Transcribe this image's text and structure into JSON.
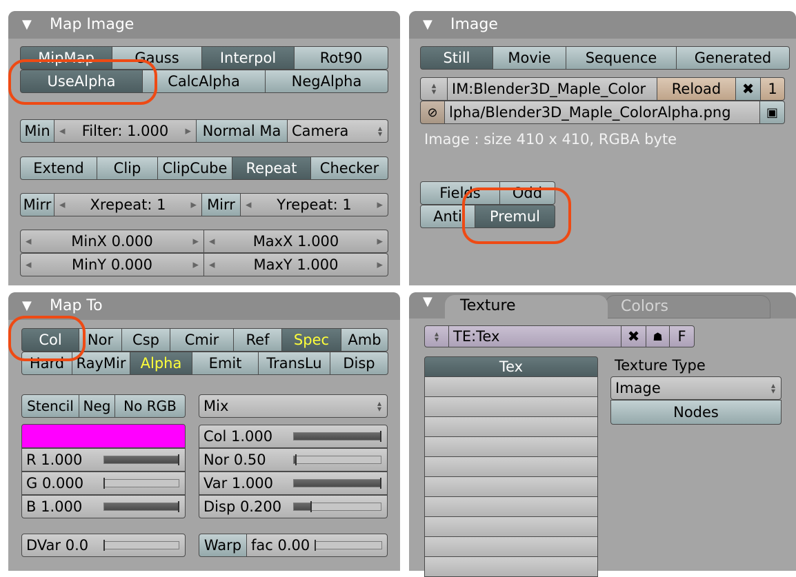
{
  "colors": {
    "highlight": "#ee4a14",
    "swatch": "#ff00ff",
    "active_button": "#4f6164",
    "yellow_text": "#ffff3a"
  },
  "map_image": {
    "title": "Map Image",
    "row1": [
      "MipMap",
      "Gauss",
      "Interpol",
      "Rot90"
    ],
    "row2": [
      "UseAlpha",
      "CalcAlpha",
      "NegAlpha"
    ],
    "filter": {
      "min_label": "Min",
      "filter_value": "Filter: 1.000",
      "normal_map": "Normal Ma",
      "space": "Camera"
    },
    "extend_row": [
      "Extend",
      "Clip",
      "ClipCube",
      "Repeat",
      "Checker"
    ],
    "repeat": {
      "mirr_x": "Mirr",
      "xrepeat": "Xrepeat: 1",
      "mirr_y": "Mirr",
      "yrepeat": "Yrepeat: 1"
    },
    "crop": {
      "minx": "MinX 0.000",
      "maxx": "MaxX 1.000",
      "miny": "MinY 0.000",
      "maxy": "MaxY 1.000"
    }
  },
  "image": {
    "title": "Image",
    "source_tabs": [
      "Still",
      "Movie",
      "Sequence",
      "Generated"
    ],
    "datablock": "IM:Blender3D_Maple_Color",
    "reload": "Reload",
    "users": "1",
    "filepath": "lpha/Blender3D_Maple_ColorAlpha.png",
    "info": "Image : size 410 x 410, RGBA byte",
    "fields": "Fields",
    "odd": "Odd",
    "anti": "Anti",
    "premul": "Premul"
  },
  "map_to": {
    "title": "Map To",
    "row1": [
      "Col",
      "Nor",
      "Csp",
      "Cmir",
      "Ref",
      "Spec",
      "Amb"
    ],
    "row2": [
      "Hard",
      "RayMir",
      "Alpha",
      "Emit",
      "TransLu",
      "Disp"
    ],
    "stencil": "Stencil",
    "neg": "Neg",
    "no_rgb": "No RGB",
    "blend_mode": "Mix",
    "r": {
      "label": "R 1.000",
      "value": 1.0
    },
    "g": {
      "label": "G 0.000",
      "value": 0.0
    },
    "b": {
      "label": "B 1.000",
      "value": 1.0
    },
    "col": {
      "label": "Col 1.000",
      "value": 1.0
    },
    "nor": {
      "label": "Nor 0.50",
      "value": 0.02
    },
    "var": {
      "label": "Var 1.000",
      "value": 1.0
    },
    "disp": {
      "label": "Disp 0.200",
      "value": 0.2
    },
    "dvar": {
      "label": "DVar 0.0",
      "value": 0.0
    },
    "warp": "Warp",
    "warp_fac": {
      "label": "fac 0.00",
      "value": 0.0
    }
  },
  "texture": {
    "tabs": [
      "Texture",
      "Colors"
    ],
    "datablock": "TE:Tex",
    "f_label": "F",
    "list_header": "Tex",
    "list_items": [
      "",
      "",
      "",
      "",
      "",
      "",
      "",
      "",
      "",
      ""
    ],
    "type_label": "Texture Type",
    "type_value": "Image",
    "nodes": "Nodes"
  }
}
